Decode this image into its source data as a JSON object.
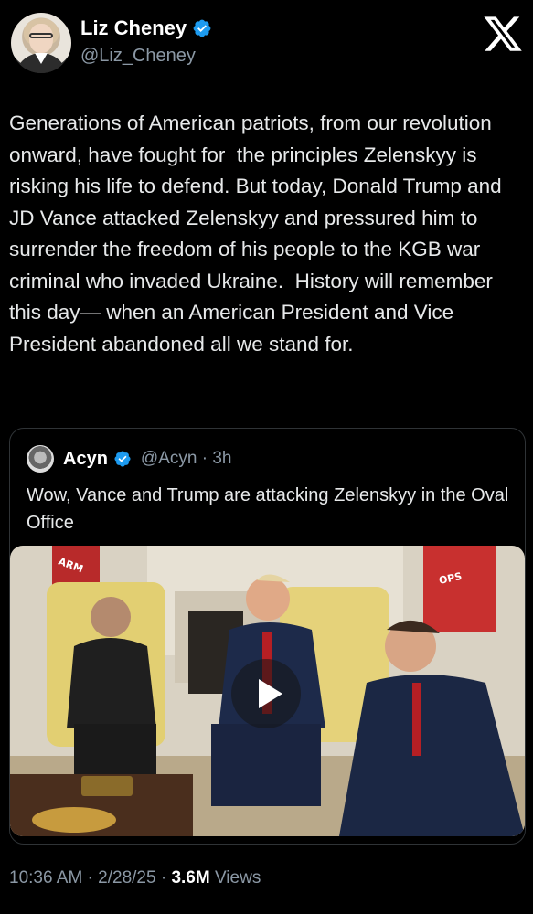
{
  "author": {
    "display_name": "Liz Cheney",
    "handle": "@Liz_Cheney"
  },
  "tweet": {
    "text": "Generations of American patriots, from our revolution onward, have fought for  the principles Zelenskyy is risking his life to defend. But today, Donald Trump and JD Vance attacked Zelenskyy and pressured him to surrender the freedom of his people to the KGB war criminal who invaded Ukraine.  History will remember this day— when an American President and Vice President abandoned all we stand for."
  },
  "quoted": {
    "display_name": "Acyn",
    "handle_time": "@Acyn · 3h",
    "text": "Wow, Vance and Trump are attacking Zelenskyy in the Oval Office",
    "media_flag_texts": [
      "ARM",
      "OPS"
    ]
  },
  "meta": {
    "timestamp": "10:36 AM · 2/28/25 · ",
    "views_count": "3.6M",
    "views_label": " Views"
  },
  "colors": {
    "background": "#000000",
    "verified_blue": "#1d9bf0",
    "secondary_text": "#8b98a5"
  },
  "icons": [
    "verified-badge-icon",
    "x-logo-icon",
    "play-icon"
  ]
}
